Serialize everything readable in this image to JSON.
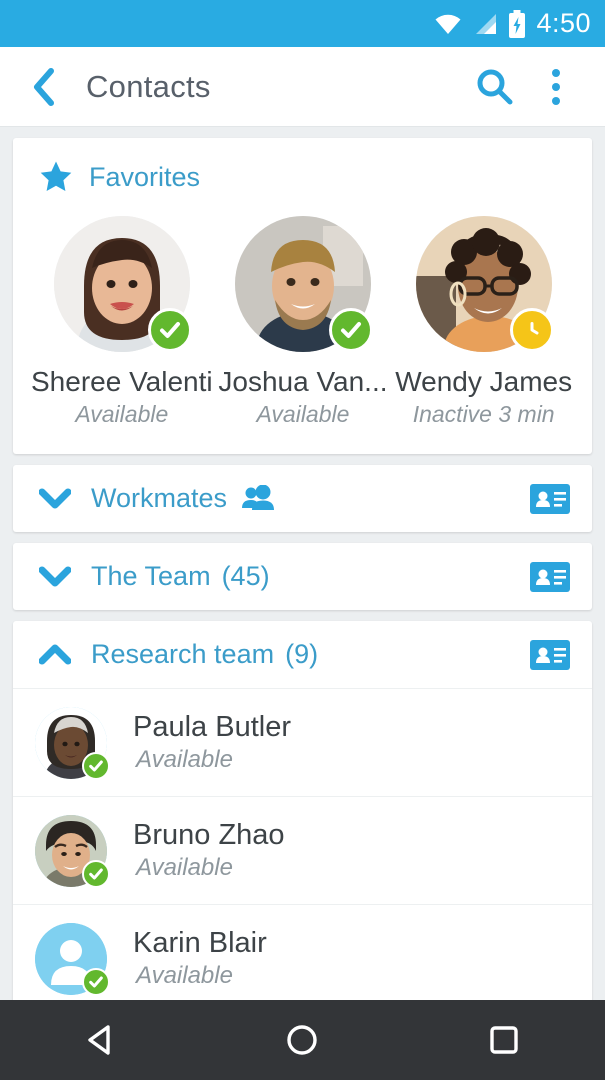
{
  "colors": {
    "accent_blue": "#29abe2",
    "link_blue": "#3b9cc9",
    "icon_blue": "#2ba4dd",
    "available_green": "#62b82e",
    "away_yellow": "#f5c518",
    "page_bg": "#eceff1",
    "card_bg": "#ffffff",
    "nav_bg": "#333538",
    "primary_text": "#3d4347",
    "secondary_text": "#8e979d",
    "avatar_placeholder": "#7fd0f0"
  },
  "statusbar": {
    "time": "4:50",
    "icons": [
      "wifi-icon",
      "cell-signal-icon",
      "battery-charging-icon"
    ]
  },
  "appbar": {
    "back_icon": "back-chevron-icon",
    "title": "Contacts",
    "search_icon": "search-icon",
    "overflow_icon": "overflow-menu-icon"
  },
  "favorites": {
    "icon": "star-icon",
    "title": "Favorites",
    "people": [
      {
        "name": "Sheree Valenti",
        "status": "Available",
        "presence": "available",
        "badge_icon": "check-icon",
        "avatar": "photo"
      },
      {
        "name": "Joshua Van...",
        "status": "Available",
        "presence": "available",
        "badge_icon": "check-icon",
        "avatar": "photo"
      },
      {
        "name": "Wendy James",
        "status": "Inactive 3 min",
        "presence": "away",
        "badge_icon": "clock-icon",
        "avatar": "photo"
      }
    ]
  },
  "groups": [
    {
      "label": "Workmates",
      "count": "",
      "expanded": false,
      "caret_icon": "chevron-down-icon",
      "inline_icon": "people-group-icon",
      "action_icon": "contact-card-icon",
      "members": []
    },
    {
      "label": "The Team",
      "count": "(45)",
      "expanded": false,
      "caret_icon": "chevron-down-icon",
      "inline_icon": "",
      "action_icon": "contact-card-icon",
      "members": []
    },
    {
      "label": "Research team",
      "count": "(9)",
      "expanded": true,
      "caret_icon": "chevron-up-icon",
      "inline_icon": "",
      "action_icon": "contact-card-icon",
      "members": [
        {
          "name": "Paula Butler",
          "status": "Available",
          "presence": "available",
          "badge_icon": "check-icon",
          "avatar": "photo"
        },
        {
          "name": "Bruno Zhao",
          "status": "Available",
          "presence": "available",
          "badge_icon": "check-icon",
          "avatar": "photo"
        },
        {
          "name": "Karin Blair",
          "status": "Available",
          "presence": "available",
          "badge_icon": "check-icon",
          "avatar": "placeholder"
        }
      ]
    }
  ],
  "navbar": {
    "back_label": "back-triangle-icon",
    "home_label": "home-circle-icon",
    "recents_label": "recents-square-icon"
  }
}
